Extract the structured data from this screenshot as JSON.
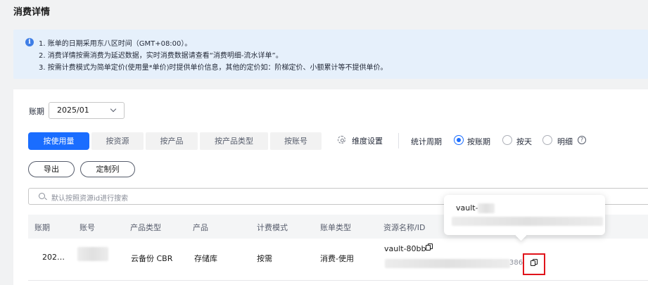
{
  "page": {
    "title": "消费详情"
  },
  "notice": {
    "lines": [
      "1. 账单的日期采用东八区时间（GMT+08:00）。",
      "2. 消费详情按需消费为延迟数据，实时消费数据请查看“消费明细-流水详单”。",
      "3. 按需计费模式为简单定价(使用量*单价)时提供单价信息，其他的定价如：阶梯定价、小额累计等不提供单价。"
    ]
  },
  "filters": {
    "period_label": "账期",
    "period_value": "2025/01",
    "dimension_tabs": [
      "按使用量",
      "按资源",
      "按产品",
      "按产品类型",
      "按账号"
    ],
    "active_tab": "按使用量",
    "dimension_settings": "维度设置",
    "cycle_label": "统计周期",
    "cycle_options": [
      "按账期",
      "按天",
      "明细"
    ],
    "cycle_selected": "按账期",
    "help": "?"
  },
  "actions": {
    "export": "导出",
    "customize_columns": "定制列"
  },
  "search": {
    "placeholder": "默认按照资源id进行搜索"
  },
  "table": {
    "columns": [
      "账期",
      "账号",
      "产品类型",
      "产品",
      "计费模式",
      "账单类型",
      "资源名称/ID"
    ],
    "rows": [
      {
        "period": "202…",
        "account": "",
        "product_type": "云备份 CBR",
        "product": "存储库",
        "billing_mode": "按需",
        "bill_type": "消费-使用",
        "resource_name": "vault-80bb",
        "resource_id_tail": "386"
      }
    ]
  },
  "tooltip": {
    "title": "vault-"
  },
  "colors": {
    "primary": "#1a6dff",
    "highlight": "#e0141b",
    "notice_bg": "#e6f0fb"
  },
  "icons": [
    "info-icon",
    "chevron-down-icon",
    "gear-icon",
    "help-icon",
    "search-icon",
    "copy-icon"
  ]
}
